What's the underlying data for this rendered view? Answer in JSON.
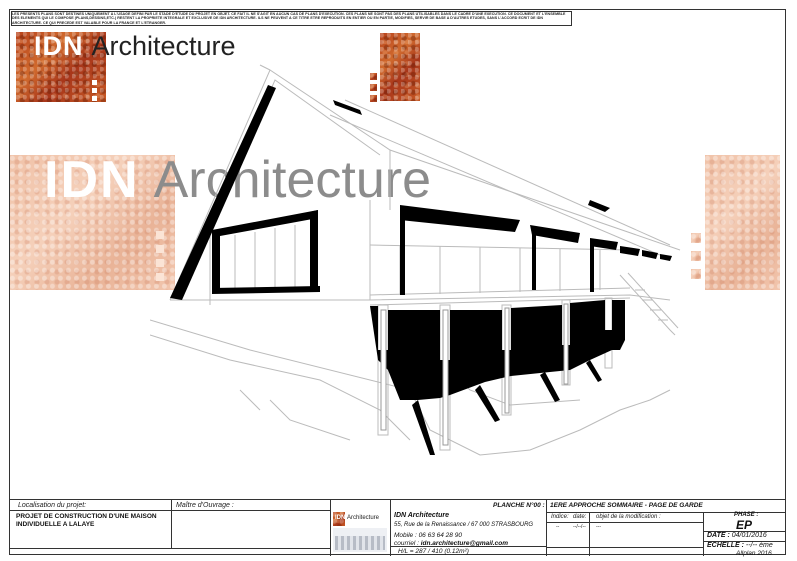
{
  "disclaimer": "LES PRESENTS PLANS SONT DESTINES UNIQUEMENT A L'USAGE DEFINI PAR LE STADE D'ETUDE DU PROJET EN OBJET. CE FAIT IL NE S'AGIT EN AUCUN CAS DE PLANS D'EXECUTION. CES PLANS NE SONT PAS DES PLANS UTILISABLES DANS LE CADRE D'UNE EXECUTION. CE DOCUMENT ET L'ENSEMBLE DES ELEMENTS QUI LE COMPOSE (PLANS,DESSINS,ETC.) RESTENT LA PROPRIETE INTEGRALE ET EXCLUSIVE DE IDN ARCHITECTURE. ILS NE PEUVENT A CE TITRE ETRE REPRODUITS EN ENTIER OU EN PARTIE, MODIFIES, SERVIR DE BASE A D'AUTRES ETUDES, SANS L'ACCORD ECRIT DE IDN ARCHITECTURE. CE QUI PRECEDE EST VALABLE POUR LA FRANCE ET L'ETRANGER.",
  "logo": {
    "idn": "IDN",
    "architecture": "Architecture"
  },
  "watermark": {
    "idn": "IDN",
    "architecture": "Architecture"
  },
  "title_block": {
    "localisation_label": "Localisation du projet:",
    "projet_line1": "PROJET DE CONSTRUCTION D'UNE MAISON",
    "projet_line2": "INDIVIDUELLE A LALAYE",
    "maitre_label": "Maître d'Ouvrage :",
    "mini_logo_idn": "IDN",
    "mini_logo_arch": "Architecture",
    "firm_name": "IDN Architecture",
    "firm_address": "55, Rue de la Renaissance / 67 000 STRASBOURG",
    "firm_mobile": "Mobile : 06 63 64 28 90",
    "firm_email_label": "courriel :",
    "firm_email": "idn.architecture@gmail.com",
    "hl": "H/L = 287 / 410 (0.12m²)",
    "planche": "PLANCHE N°00 :",
    "planche_title": "1ERE APPROCHE SOMMAIRE - PAGE DE GARDE",
    "indice_label": "Indice:",
    "date_col_label": "date:",
    "objet_label": "objet de la modification :",
    "indice_val": "--",
    "date_col_val": "--/--/--",
    "objet_val": "---",
    "phase_label": "PHASE :",
    "phase_val": "EP",
    "date_label": "DATE :",
    "date_val": "04/01/2016",
    "echelle_label": "ECHELLE :",
    "echelle_val": "--/-- ème",
    "software": "Allplan 2016"
  }
}
